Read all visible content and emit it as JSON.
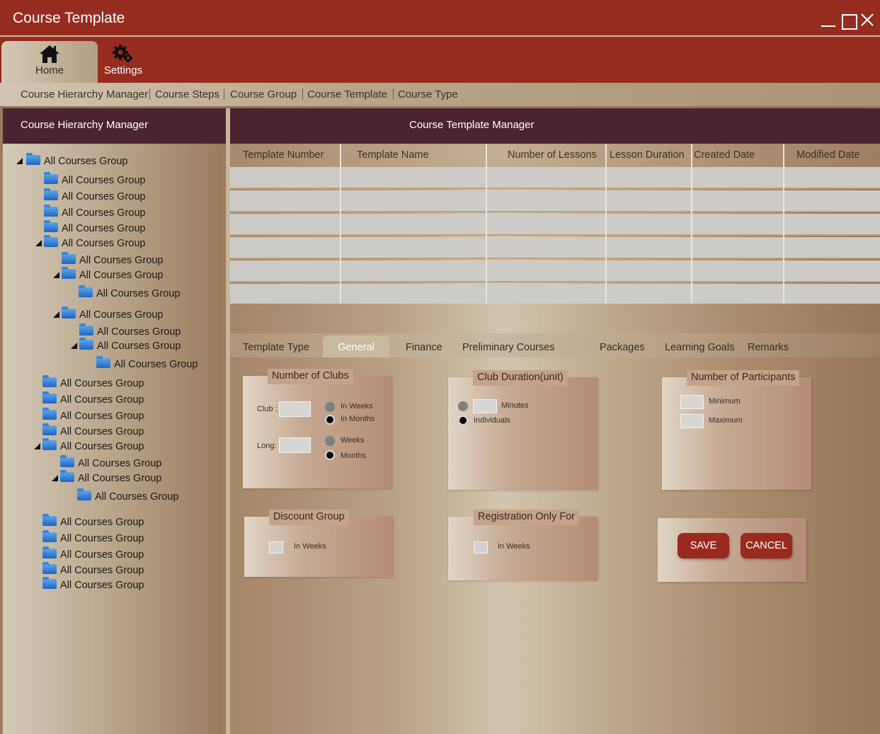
{
  "window": {
    "title": "Course Template"
  },
  "ribbon": {
    "tabs": [
      {
        "label": "Home",
        "icon": "home-icon"
      },
      {
        "label": "Settings",
        "icon": "gear-icon"
      }
    ]
  },
  "subnav": {
    "items": [
      "Course Hierarchy Manager",
      "Course Steps",
      "Course Group",
      "Course Template",
      "Course Type"
    ]
  },
  "left_panel": {
    "title": "Course Hierarchy Manager",
    "tree": [
      "All Courses Group",
      "All Courses Group",
      "All Courses Group",
      "All Courses Group",
      "All Courses Group",
      "All Courses Group",
      "All Courses Group",
      "All Courses Group",
      "All Courses Group",
      "All Courses Group",
      "All Courses Group",
      "All Courses Group",
      "All Courses Group",
      "All Courses Group",
      "All Courses Group",
      "All Courses Group",
      "All Courses Group",
      "All Courses Group",
      "All Courses Group",
      "All Courses Group",
      "All Courses Group",
      "All Courses Group",
      "All Courses Group",
      "All Courses Group",
      "All Courses Group",
      "All Courses Group",
      "All Courses Group"
    ]
  },
  "right_panel": {
    "title": "Course Template Manager",
    "columns": [
      "Template Number",
      "Template Name",
      "Number of Lessons",
      "Lesson Duration",
      "Created Date",
      "Modified Date"
    ],
    "detail_tabs": [
      "Template Type",
      "General",
      "Finance",
      "Preliminary Courses",
      "Packages",
      "Learning Goals",
      "Remarks"
    ],
    "active_tab": "General"
  },
  "form": {
    "clubs": {
      "legend": "Number of Clubs",
      "club_label": "Club :",
      "long_label": "Long:",
      "in_weeks": "In Weeks",
      "in_months": "In Months",
      "weeks": "Weeks",
      "months": "Months"
    },
    "duration": {
      "legend": "Club Duration(unit)",
      "minutes": "Minutes",
      "individuals": "Individuals"
    },
    "participants": {
      "legend": "Number of Participants",
      "minimum": "Minimum",
      "maximum": "Maximum"
    },
    "discount": {
      "legend": "Discount Group",
      "in_weeks": "In Weeks"
    },
    "registration": {
      "legend": "Registration Only For",
      "in_weeks": "In Weeks"
    },
    "actions": {
      "save": "SAVE",
      "cancel": "CANCEL"
    }
  }
}
